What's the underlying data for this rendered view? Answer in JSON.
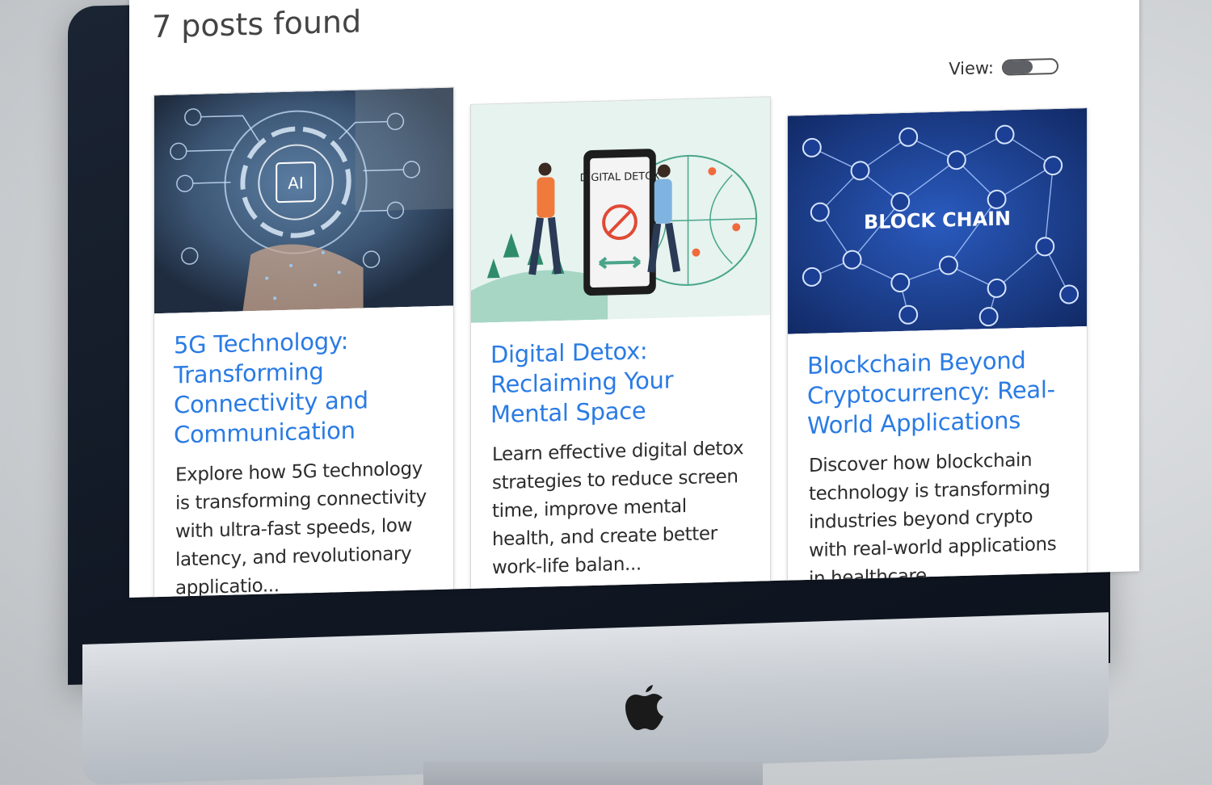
{
  "header": {
    "posts_count": "7 posts found",
    "view_label": "View:"
  },
  "posts": [
    {
      "image_icon": "ai-technology-image",
      "image_text": "AI",
      "title": "5G Technology: Transforming Connectivity and Communication",
      "excerpt": "Explore how 5G technology is transforming connectivity with ultra-fast speeds, low latency, and revolutionary applicatio..."
    },
    {
      "image_icon": "digital-detox-illustration",
      "image_text": "DIGITAL DETOX",
      "title": "Digital Detox: Reclaiming Your Mental Space",
      "excerpt": "Learn effective digital detox strategies to reduce screen time, improve mental health, and create better work-life balan..."
    },
    {
      "image_icon": "blockchain-network-image",
      "image_text": "BLOCK CHAIN",
      "title": "Blockchain Beyond Cryptocurrency: Real-World Applications",
      "excerpt": "Discover how blockchain technology is transforming industries beyond crypto with real-world applications in healthcare, ..."
    }
  ],
  "colors": {
    "link": "#2a7be4",
    "bezel": "#111824",
    "blockchain_bg": "#1c3f8f",
    "detox_bg": "#e6f3ef"
  }
}
